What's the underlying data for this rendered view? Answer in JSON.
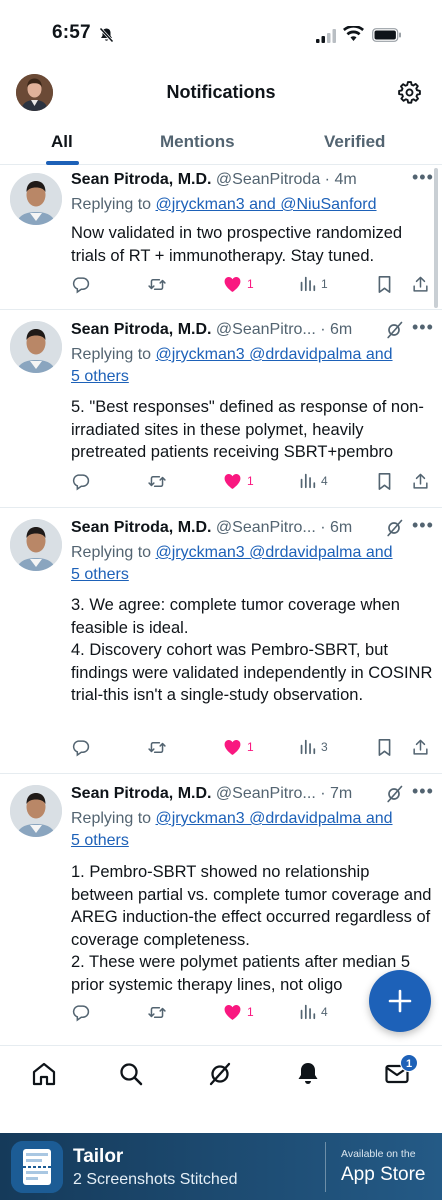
{
  "status_bar": {
    "time": "6:57"
  },
  "header": {
    "title": "Notifications"
  },
  "tabs": [
    {
      "label": "All",
      "active": true
    },
    {
      "label": "Mentions",
      "active": false
    },
    {
      "label": "Verified",
      "active": false
    }
  ],
  "tweets": [
    {
      "name": "Sean Pitroda, M.D.",
      "handle": "@SeanPitroda",
      "time": "4m",
      "replying_prefix": "Replying to ",
      "replying_links": "@jryckman3 and @NiuSanford",
      "replying_links2": "",
      "text": "Now validated in two prospective randomized trials of RT + immunotherapy. Stay tuned.",
      "likes": "1",
      "views": "1"
    },
    {
      "name": "Sean Pitroda, M.D.",
      "handle": "@SeanPitro...",
      "time": "6m",
      "replying_prefix": "Replying to ",
      "replying_links": "@jryckman3 @drdavidpalma and",
      "replying_links2": "5 others",
      "text": "5. \"Best responses\" defined as response of non-irradiated sites in these polymet, heavily pretreated patients receiving SBRT+pembro",
      "likes": "1",
      "views": "4"
    },
    {
      "name": "Sean Pitroda, M.D.",
      "handle": "@SeanPitro...",
      "time": "6m",
      "replying_prefix": "Replying to ",
      "replying_links": "@jryckman3 @drdavidpalma and",
      "replying_links2": "5 others",
      "text": "3. We agree: complete tumor coverage when feasible is ideal.\n4. Discovery cohort was Pembro-SBRT, but findings were validated independently in COSINR trial-this isn't a single-study observation.",
      "likes": "1",
      "views": "3"
    },
    {
      "name": "Sean Pitroda, M.D.",
      "handle": "@SeanPitro...",
      "time": "7m",
      "replying_prefix": "Replying to ",
      "replying_links": "@jryckman3 @drdavidpalma and",
      "replying_links2": "5 others",
      "text": "1. Pembro-SBRT showed no relationship between partial vs. complete tumor coverage and AREG induction-the effect occurred regardless of coverage completeness.\n2. These were polymet patients after median 5 prior systemic therapy lines, not oligo",
      "likes": "1",
      "views": "4"
    }
  ],
  "nav": {
    "messages_badge": "1"
  },
  "banner": {
    "app_name": "Tailor",
    "subtitle": "2 Screenshots Stitched",
    "available": "Available on the",
    "store": "App Store"
  },
  "colors": {
    "accent": "#1d61b8",
    "like": "#f91880",
    "muted": "#536471"
  }
}
